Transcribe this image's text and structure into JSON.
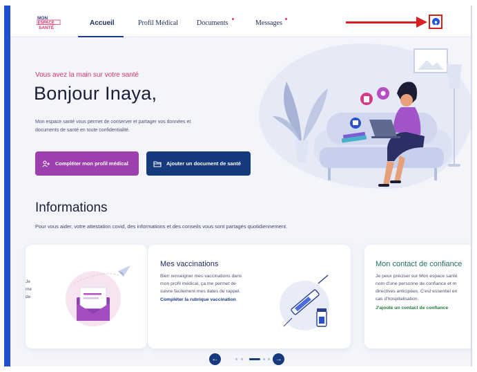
{
  "header": {
    "logo_lines": [
      "MON",
      "ESPACE",
      "SANTÉ"
    ],
    "nav": [
      {
        "label": "Accueil",
        "active": true
      },
      {
        "label": "Profil Médical",
        "active": false
      },
      {
        "label": "Documents",
        "active": false,
        "notification": true
      },
      {
        "label": "Messages",
        "active": false,
        "notification": true
      }
    ]
  },
  "hero": {
    "tagline": "Vous avez la main sur votre santé",
    "greeting": "Bonjour Inaya,",
    "intro_line1": "Mon espace santé vous permet de conserver et partager vos données et",
    "intro_line2": "documents de santé en toute confidentialité.",
    "btn_profile": "Compléter mon profil médical",
    "btn_document": "Ajouter un document de santé"
  },
  "informations": {
    "title": "Informations",
    "subtitle": "Pour vous aider, votre attestation covid, des informations et des conseils vous sont partagés quotidiennement.",
    "card_left_edge": [
      "Je",
      "me",
      "de"
    ],
    "cards": [
      {
        "title": "Mes vaccinations",
        "lines": [
          "Bien renseigner mes vaccinations dans",
          "mon profil médical, ça me permet de",
          "suivre facilement mes dates de rappel."
        ],
        "link": "Compléter la rubrique vaccination"
      },
      {
        "title": "Mon contact de confiance",
        "lines": [
          "Je peux préciser sur Mon espace santé",
          "nom d'une personne de confiance et m",
          "directives anticipées. C'est essentiel en",
          "cas d'hospitalisation."
        ],
        "link": "J'ajoute un contact de confiance"
      }
    ]
  },
  "carousel": {
    "prev_glyph": "←",
    "next_glyph": "→"
  },
  "colors": {
    "primary": "#163a7e",
    "accent_pink": "#d6336c",
    "accent_purple": "#9d3fae",
    "link_green": "#1f7a3f",
    "annotation_red": "#d61f1f"
  },
  "icons": [
    "user-avatar-icon",
    "add-user-icon",
    "folder-icon",
    "arrow-left-icon",
    "arrow-right-icon",
    "paper-plane-icon",
    "envelope-icon",
    "syringe-icon",
    "vial-icon"
  ]
}
